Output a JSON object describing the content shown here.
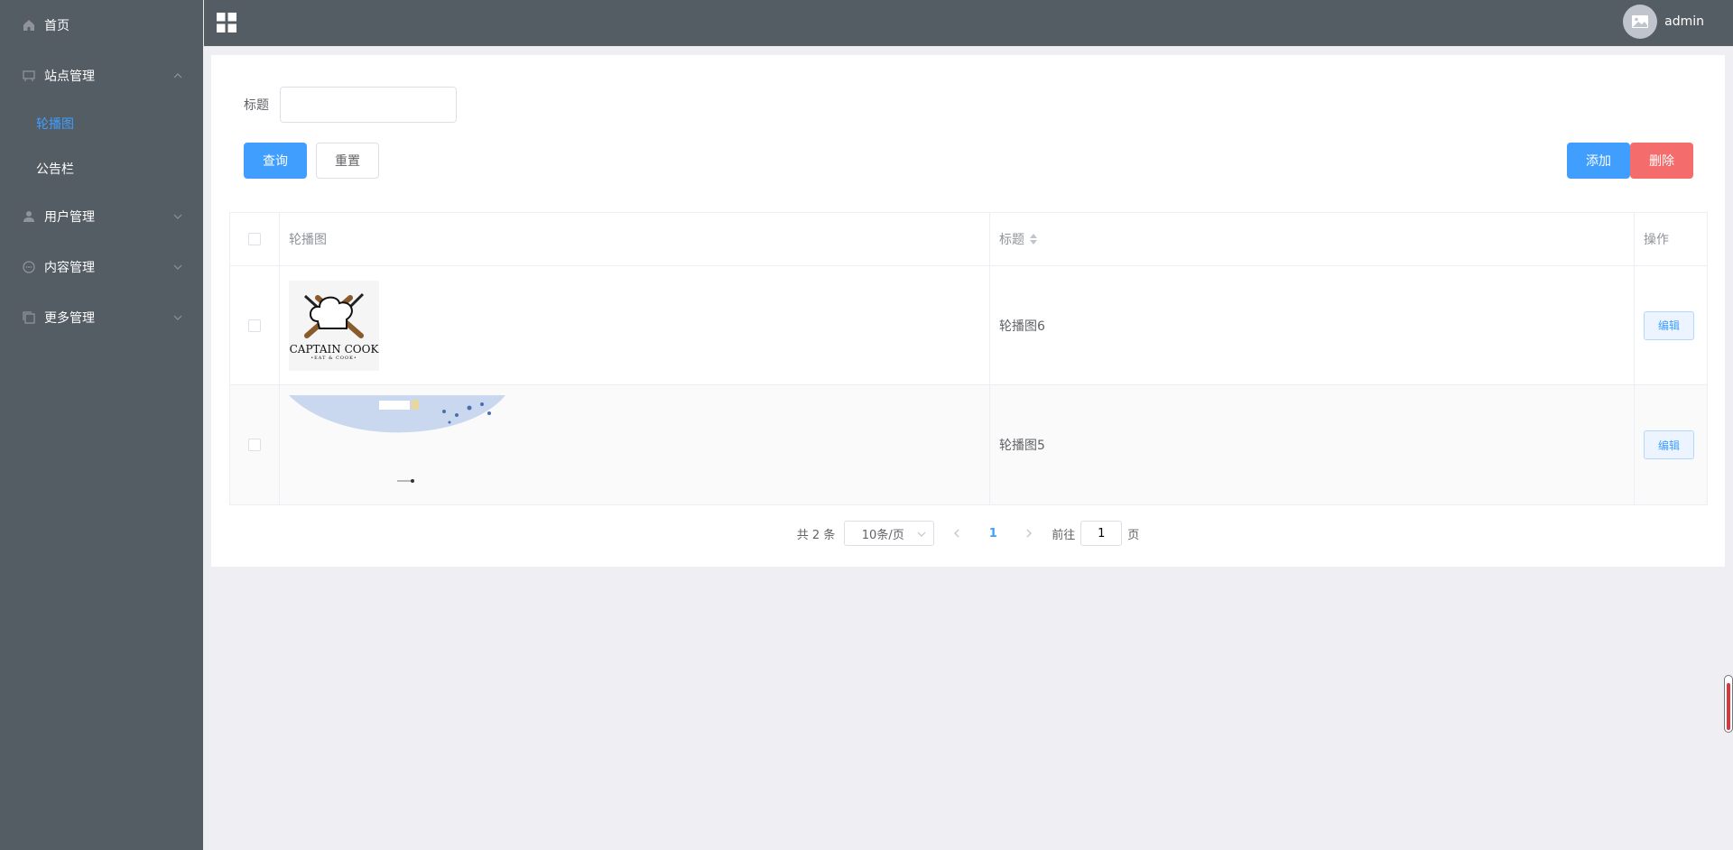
{
  "sidebar": {
    "items": [
      {
        "label": "首页"
      },
      {
        "label": "站点管理"
      },
      {
        "label": "用户管理"
      },
      {
        "label": "内容管理"
      },
      {
        "label": "更多管理"
      }
    ],
    "submenu": [
      {
        "label": "轮播图"
      },
      {
        "label": "公告栏"
      }
    ]
  },
  "header": {
    "username": "admin"
  },
  "search": {
    "label": "标题",
    "value": "",
    "placeholder": ""
  },
  "actions": {
    "query": "查询",
    "reset": "重置",
    "add": "添加",
    "delete": "删除"
  },
  "table": {
    "headers": {
      "image": "轮播图",
      "title": "标题",
      "operation": "操作"
    },
    "rows": [
      {
        "title": "轮播图6",
        "edit": "编辑",
        "image_caption": "CAPTAIN COOK",
        "image_sub": "•EAT & COOK•"
      },
      {
        "title": "轮播图5",
        "edit": "编辑"
      }
    ]
  },
  "pagination": {
    "total": "共 2 条",
    "page_size": "10条/页",
    "current": "1",
    "goto_prefix": "前往",
    "goto_value": "1",
    "goto_suffix": "页"
  },
  "colors": {
    "sidebar_bg": "#545c64",
    "primary": "#409eff",
    "danger": "#f56c6c"
  }
}
